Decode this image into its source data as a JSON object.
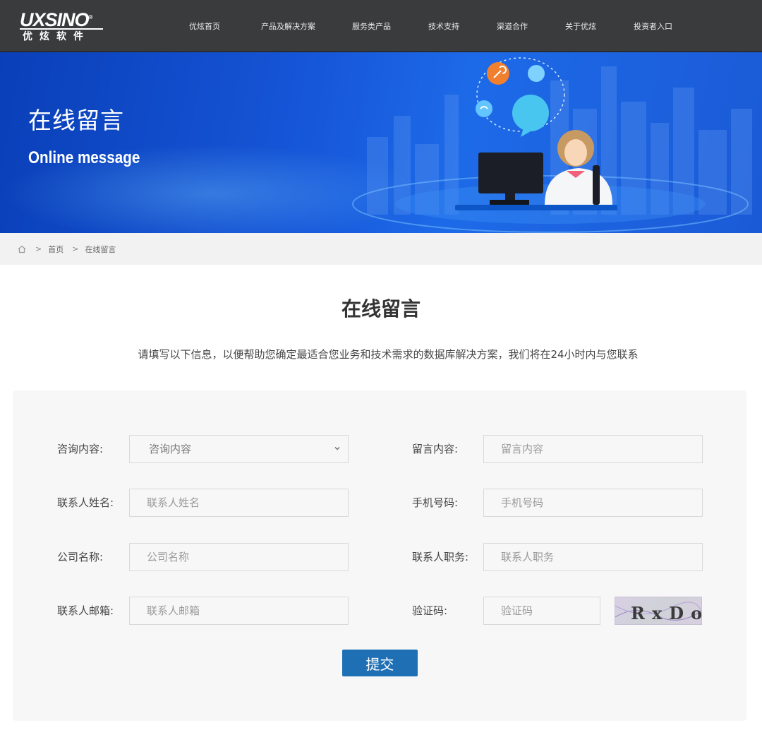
{
  "logo": {
    "brand": "UXSINO",
    "reg": "®",
    "sub": "优炫软件"
  },
  "nav": [
    "优炫首页",
    "产品及解决方案",
    "服务类产品",
    "技术支持",
    "渠道合作",
    "关于优炫",
    "投资者入口"
  ],
  "banner": {
    "title": "在线留言",
    "subtitle": "Online message"
  },
  "breadcrumb": {
    "home": "首页",
    "current": "在线留言",
    "sep": ">"
  },
  "section": {
    "title": "在线留言",
    "description": "请填写以下信息，以便帮助您确定最适合您业务和技术需求的数据库解决方案，我们将在24小时内与您联系"
  },
  "form": {
    "consult": {
      "label": "咨询内容:",
      "selected": "咨询内容"
    },
    "message": {
      "label": "留言内容:",
      "placeholder": "留言内容"
    },
    "name": {
      "label": "联系人姓名:",
      "placeholder": "联系人姓名"
    },
    "phone": {
      "label": "手机号码:",
      "placeholder": "手机号码"
    },
    "company": {
      "label": "公司名称:",
      "placeholder": "公司名称"
    },
    "position": {
      "label": "联系人职务:",
      "placeholder": "联系人职务"
    },
    "email": {
      "label": "联系人邮箱:",
      "placeholder": "联系人邮箱"
    },
    "captcha": {
      "label": "验证码:",
      "placeholder": "验证码",
      "image_text": "RxDo"
    },
    "submit_label": "提交"
  },
  "colors": {
    "header": "#3a3b3d",
    "banner": "#1656d8",
    "submit": "#1f6fb5",
    "panel": "#f7f7f7"
  }
}
